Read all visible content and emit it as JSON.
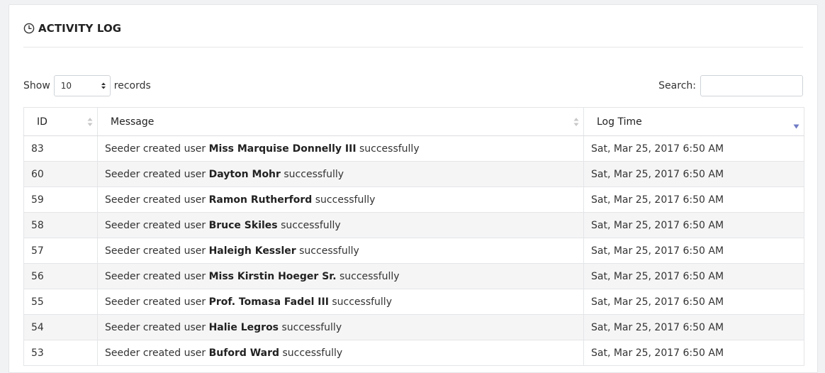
{
  "panel": {
    "title": "ACTIVITY LOG",
    "icon": "clock-icon"
  },
  "controls": {
    "show_label": "Show",
    "page_length": "10",
    "records_label": "records",
    "search_label": "Search:",
    "search_value": ""
  },
  "table": {
    "columns": [
      "ID",
      "Message",
      "Log Time"
    ],
    "sorted_column": "Log Time",
    "sort_direction": "descending",
    "rows": [
      {
        "id": "83",
        "prefix": "Seeder created user ",
        "user": "Miss Marquise Donnelly III",
        "suffix": " successfully",
        "time": "Sat, Mar 25, 2017 6:50 AM"
      },
      {
        "id": "60",
        "prefix": "Seeder created user ",
        "user": "Dayton Mohr",
        "suffix": " successfully",
        "time": "Sat, Mar 25, 2017 6:50 AM"
      },
      {
        "id": "59",
        "prefix": "Seeder created user ",
        "user": "Ramon Rutherford",
        "suffix": " successfully",
        "time": "Sat, Mar 25, 2017 6:50 AM"
      },
      {
        "id": "58",
        "prefix": "Seeder created user ",
        "user": "Bruce Skiles",
        "suffix": " successfully",
        "time": "Sat, Mar 25, 2017 6:50 AM"
      },
      {
        "id": "57",
        "prefix": "Seeder created user ",
        "user": "Haleigh Kessler",
        "suffix": " successfully",
        "time": "Sat, Mar 25, 2017 6:50 AM"
      },
      {
        "id": "56",
        "prefix": "Seeder created user ",
        "user": "Miss Kirstin Hoeger Sr.",
        "suffix": " successfully",
        "time": "Sat, Mar 25, 2017 6:50 AM"
      },
      {
        "id": "55",
        "prefix": "Seeder created user ",
        "user": "Prof. Tomasa Fadel III",
        "suffix": " successfully",
        "time": "Sat, Mar 25, 2017 6:50 AM"
      },
      {
        "id": "54",
        "prefix": "Seeder created user ",
        "user": "Halie Legros",
        "suffix": " successfully",
        "time": "Sat, Mar 25, 2017 6:50 AM"
      },
      {
        "id": "53",
        "prefix": "Seeder created user ",
        "user": "Buford Ward",
        "suffix": " successfully",
        "time": "Sat, Mar 25, 2017 6:50 AM"
      }
    ]
  },
  "colors": {
    "page_background": "#f1f2f4",
    "panel_background": "#ffffff",
    "striped_row": "#f5f5f6",
    "sort_active": "#6f7bc4",
    "sort_inactive": "#c8c8c8"
  }
}
